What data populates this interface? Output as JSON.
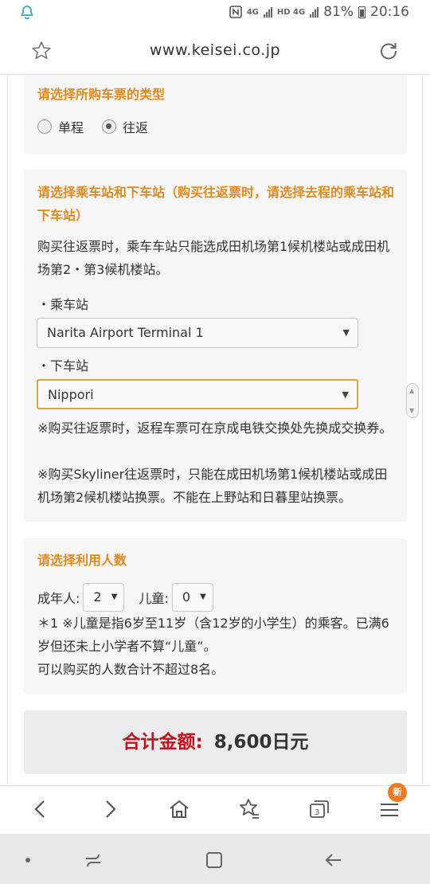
{
  "status_bar": {
    "network_a": "4G",
    "network_b": "HD 4G",
    "battery": "81%",
    "time": "20:16"
  },
  "browser": {
    "url": "www.keisei.co.jp",
    "tab_badge": "新"
  },
  "ticket_type": {
    "title": "请选择所购车票的类型",
    "options": [
      "单程",
      "往返"
    ],
    "selected": "往返"
  },
  "stations": {
    "title": "请选择乘车站和下车站（购买往返票时，请选择去程的乘车站和下车站）",
    "note": "购买往返票时，乘车车站只能选成田机场第1候机楼站或成田机场第2・第3候机楼站。",
    "departure_label": "・乘车站",
    "departure_value": "Narita Airport Terminal 1",
    "arrival_label": "・下车站",
    "arrival_value": "Nippori",
    "notice_1": "※购买往返票时，返程车票可在京成电铁交换处先换成交换券。",
    "notice_2": "※购买Skyliner往返票时，只能在成田机场第1候机楼站或成田机场第2候机楼站换票。不能在上野站和日暮里站换票。"
  },
  "passengers": {
    "title": "请选择利用人数",
    "adult_label": "成年人:",
    "adult_value": "2",
    "child_label": "儿童:",
    "child_value": "0",
    "note_1": "＊1 ※儿童是指6岁至11岁（含12岁的小学生）的乘客。已满6岁但还未上小学者不算“儿童”。",
    "note_2": "可以购买的人数合计不超过8名。"
  },
  "total": {
    "label": "合计金额:",
    "amount": "8,600日元"
  },
  "colors": {
    "section_title": "#e08a1e",
    "total_label": "#c3121b",
    "badge": "#f07a22"
  }
}
